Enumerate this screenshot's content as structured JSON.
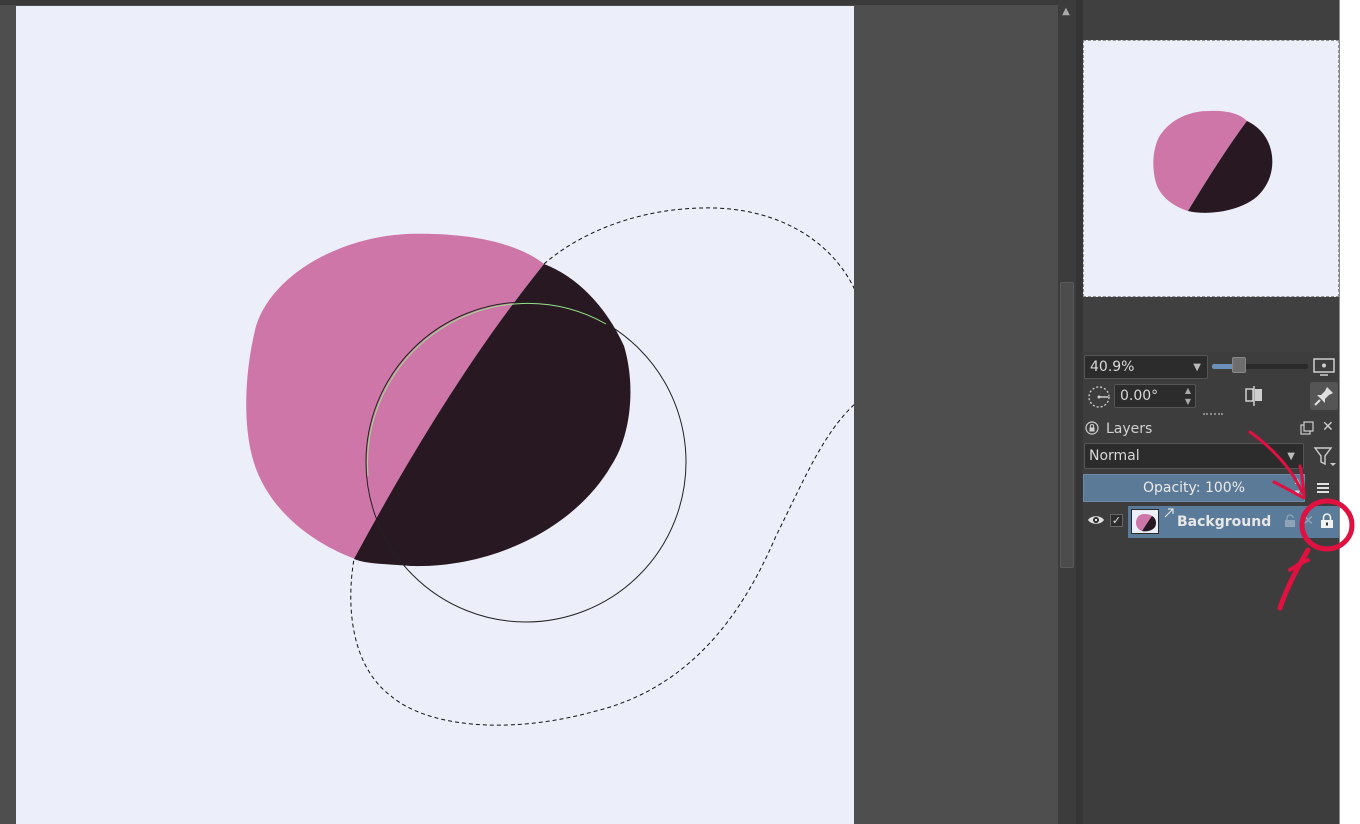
{
  "overview": {
    "zoom_level": "40.9%",
    "zoom_slider_fraction": 0.27,
    "rotation": "0.00°"
  },
  "layers_panel": {
    "title": "Layers",
    "blend_mode": "Normal",
    "opacity_label": "Opacity:  100%",
    "layers": [
      {
        "name": "Background",
        "visible": true,
        "selected": true,
        "locked": true
      }
    ]
  },
  "colors": {
    "canvas": "#eceef9",
    "pink_shape": "#cf76a9",
    "dark_shape": "#281822",
    "workspace": "#4e4e4e",
    "panel": "#3d3d3d",
    "selected_row": "#5a7b9a",
    "annotation": "#e01040"
  },
  "icons": [
    "lock-icon",
    "float-icon",
    "close-icon",
    "filter-icon",
    "menu-icon",
    "eye-icon",
    "pin-icon",
    "mirror-icon",
    "rotate-icon",
    "fit-canvas-icon"
  ]
}
